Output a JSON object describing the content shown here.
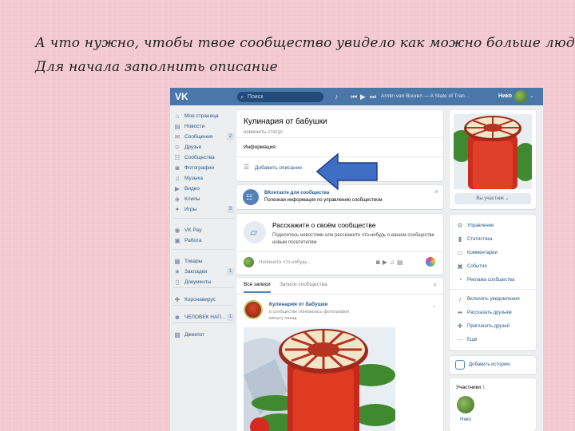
{
  "caption": {
    "line1": "А что нужно, чтобы твое сообщество увидело как можно больше людей?",
    "line2": "Для начала заполнить описание"
  },
  "topbar": {
    "logo": "VK",
    "search_placeholder": "Поиск",
    "track": "Armin van Buuren — A State of Tran...",
    "user_name": "Нико"
  },
  "sidebar": {
    "items": [
      {
        "label": "Моя страница",
        "icon": "home-icon",
        "glyph": "⌂"
      },
      {
        "label": "Новости",
        "icon": "news-icon",
        "glyph": "▤"
      },
      {
        "label": "Сообщения",
        "icon": "messages-icon",
        "glyph": "✉",
        "count": "2"
      },
      {
        "label": "Друзья",
        "icon": "friends-icon",
        "glyph": "☺"
      },
      {
        "label": "Сообщества",
        "icon": "groups-icon",
        "glyph": "☷"
      },
      {
        "label": "Фотографии",
        "icon": "photos-icon",
        "glyph": "◙"
      },
      {
        "label": "Музыка",
        "icon": "music-icon",
        "glyph": "♫"
      },
      {
        "label": "Видео",
        "icon": "video-icon",
        "glyph": "▶"
      },
      {
        "label": "Клипы",
        "icon": "clips-icon",
        "glyph": "◈"
      },
      {
        "label": "Игры",
        "icon": "games-icon",
        "glyph": "✦",
        "count": "3"
      },
      {
        "label": "VK Pay",
        "icon": "vkpay-icon",
        "glyph": "◉"
      },
      {
        "label": "Работа",
        "icon": "work-icon",
        "glyph": "▣"
      },
      {
        "label": "Товары",
        "icon": "goods-icon",
        "glyph": "▦"
      },
      {
        "label": "Закладки",
        "icon": "bookmarks-icon",
        "glyph": "★",
        "count": "1"
      },
      {
        "label": "Документы",
        "icon": "documents-icon",
        "glyph": "▯"
      },
      {
        "label": "Коронавирус",
        "icon": "coronavirus-icon",
        "glyph": "✚"
      },
      {
        "label": "ЧЕЛОВЕК НАП...",
        "icon": "app-icon",
        "glyph": "☻",
        "count": "1"
      },
      {
        "label": "Джекпот",
        "icon": "jackpot-icon",
        "glyph": "▩"
      }
    ]
  },
  "group": {
    "title": "Кулинария от бабушки",
    "status": "изменить статус",
    "info_label": "Информация",
    "add_description": "Добавить описание"
  },
  "notice": {
    "title": "ВКонтакте для сообщества",
    "text": "Полезная информация по управлению сообществом"
  },
  "tell": {
    "title": "Расскажите о своём сообществе",
    "text": "Поделитесь новостями или расскажите что-нибудь о вашем сообществе новым посетителям",
    "composer_placeholder": "Напишите что-нибудь..."
  },
  "feed": {
    "tab_all": "Все записи",
    "tab_community": "Записи сообщества",
    "post": {
      "author": "Кулинария от бабушки",
      "action": "в сообществе обновилась фотография",
      "time": "минуту назад"
    }
  },
  "cover": {
    "member_button": "Вы участник ⌄"
  },
  "menu": {
    "items": [
      {
        "label": "Управление",
        "icon": "settings-icon",
        "glyph": "⚙"
      },
      {
        "label": "Статистика",
        "icon": "statistics-icon",
        "glyph": "▮"
      },
      {
        "label": "Комментарии",
        "icon": "comments-icon",
        "glyph": "▭"
      },
      {
        "label": "События",
        "icon": "events-icon",
        "glyph": "▣"
      },
      {
        "label": "Реклама сообщества",
        "icon": "advertising-icon",
        "glyph": "◔"
      },
      {
        "label": "Включить уведомления",
        "icon": "bell-icon",
        "glyph": "♪"
      },
      {
        "label": "Рассказать друзьям",
        "icon": "share-icon",
        "glyph": "➦"
      },
      {
        "label": "Пригласить друзей",
        "icon": "invite-icon",
        "glyph": "✚"
      },
      {
        "label": "Ещё",
        "icon": "more-icon",
        "glyph": "⋯"
      }
    ]
  },
  "story": {
    "label": "Добавить историю"
  },
  "members": {
    "label": "Участники",
    "count": "1",
    "name": "Нико"
  },
  "colors": {
    "brand": "#4a76a8",
    "link": "#2a5885",
    "arrow": "#3f6fc4",
    "slide_background": "#f3c9d2"
  }
}
